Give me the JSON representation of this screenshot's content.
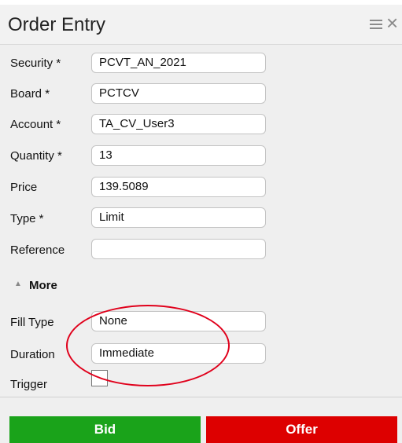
{
  "window": {
    "title": "Order Entry",
    "menu_icon": "hamburger-menu-icon",
    "close_icon": "close-icon",
    "close_glyph": "×"
  },
  "form": {
    "security": {
      "label": "Security *",
      "value": "PCVT_AN_2021"
    },
    "board": {
      "label": "Board *",
      "value": "PCTCV"
    },
    "account": {
      "label": "Account *",
      "value": "TA_CV_User3"
    },
    "quantity": {
      "label": "Quantity *",
      "value": "13"
    },
    "price": {
      "label": "Price",
      "value": "139.5089"
    },
    "type": {
      "label": "Type *",
      "value": "Limit"
    },
    "reference": {
      "label": "Reference",
      "value": ""
    }
  },
  "more": {
    "arrow_icon": "caret-up-icon",
    "arrow_glyph": "▲",
    "label": "More"
  },
  "advanced": {
    "fill_type": {
      "label": "Fill Type",
      "value": "None"
    },
    "duration": {
      "label": "Duration",
      "value": "Immediate"
    },
    "trigger": {
      "label": "Trigger",
      "checked": false
    }
  },
  "actions": {
    "bid_label": "Bid",
    "offer_label": "Offer",
    "bid_color": "#1aa31a",
    "offer_color": "#dd0000"
  },
  "annotation": {
    "color": "#e0001b"
  }
}
